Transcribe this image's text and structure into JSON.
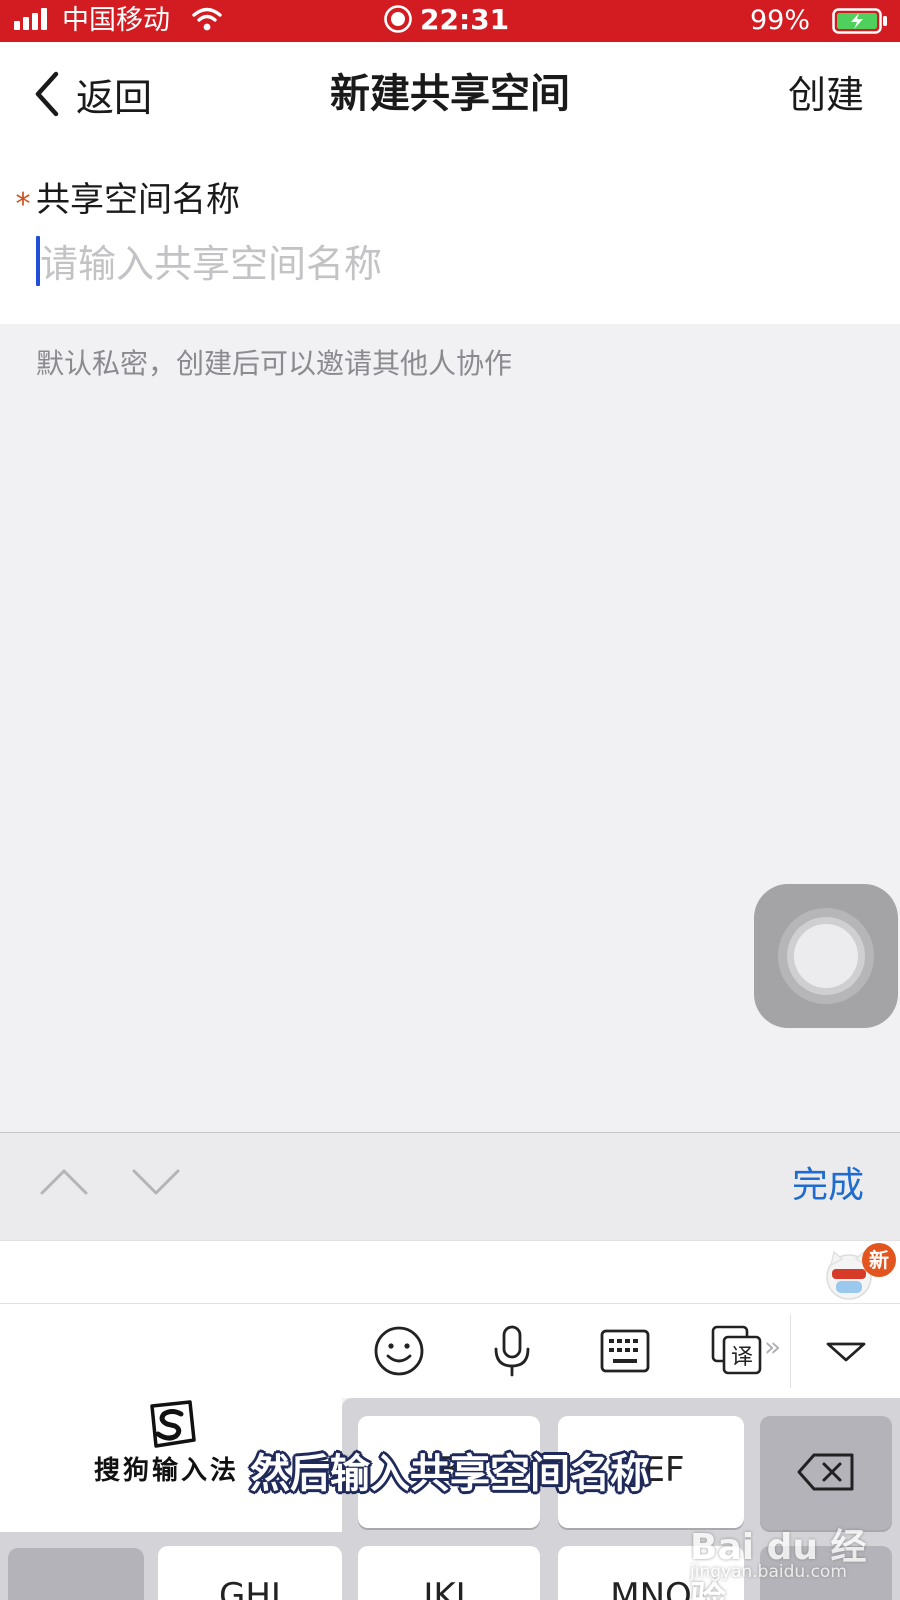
{
  "status_bar": {
    "carrier": "中国移动",
    "time": "22:31",
    "battery_percent": "99%",
    "icons": [
      "signal-icon",
      "wifi-icon",
      "screen-record-icon",
      "battery-charging-icon"
    ]
  },
  "nav": {
    "back_label": "返回",
    "title": "新建共享空间",
    "create_label": "创建"
  },
  "form": {
    "required_mark": "*",
    "name_label": "共享空间名称",
    "name_value": "",
    "name_placeholder": "请输入共享空间名称"
  },
  "hint": "默认私密，创建后可以邀请其他人协作",
  "accessory_bar": {
    "done_label": "完成",
    "icons": [
      "chevron-up-icon",
      "chevron-down-icon"
    ]
  },
  "ime": {
    "new_badge": "新",
    "brand": "搜狗输入法",
    "toolbar_icons": [
      "emoji-icon",
      "microphone-icon",
      "keyboard-icon",
      "translate-icon",
      "collapse-keyboard-icon"
    ],
    "keys": {
      "abc": "ABC",
      "def": "DEF",
      "ghi": "GHI",
      "jkl": "JKL",
      "mno": "MNO"
    },
    "delete_icon": "backspace-icon"
  },
  "overlay": {
    "caption": "然后输入共享空间名称",
    "watermark_brand": "Bai du 经验",
    "watermark_url": "jingyan.baidu.com"
  },
  "colors": {
    "status_bar_bg": "#d21c22",
    "accent_blue": "#1e6ccf",
    "required_orange": "#d0501c",
    "background_gray": "#f1f1f3"
  }
}
